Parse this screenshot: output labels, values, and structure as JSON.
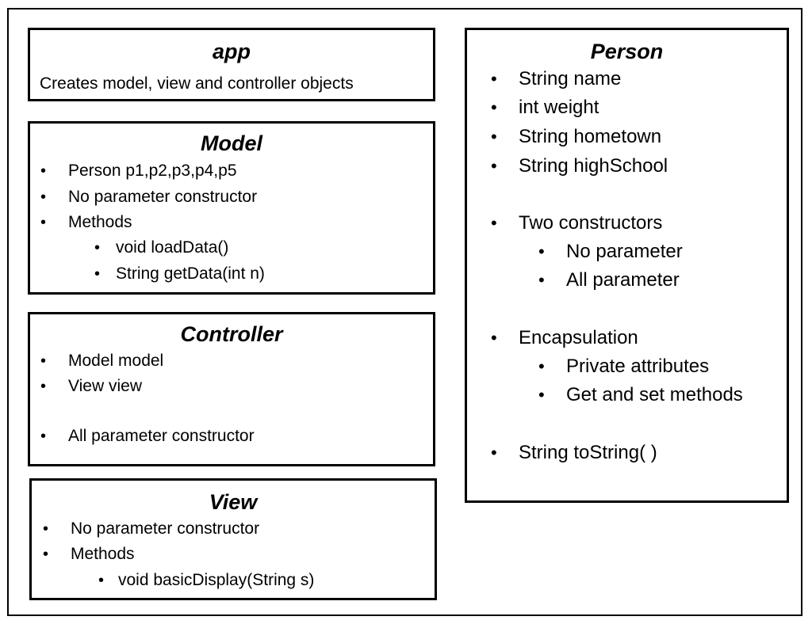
{
  "app": {
    "title": "app",
    "description": "Creates model, view and controller objects"
  },
  "model": {
    "title": "Model",
    "items": [
      "Person p1,p2,p3,p4,p5",
      "No parameter constructor",
      "Methods",
      "void loadData()",
      "String getData(int n)"
    ]
  },
  "controller": {
    "title": "Controller",
    "items": [
      "Model model",
      "View view",
      "All parameter constructor"
    ]
  },
  "view": {
    "title": "View",
    "items": [
      "No parameter constructor",
      "Methods",
      "void basicDisplay(String s)"
    ]
  },
  "person": {
    "title": "Person",
    "items": [
      "String name",
      "int weight",
      "String hometown",
      "String highSchool",
      "Two constructors",
      "No parameter",
      "All parameter",
      "Encapsulation",
      "Private attributes",
      "Get and set methods",
      "String toString( )"
    ]
  },
  "bullet": "•"
}
